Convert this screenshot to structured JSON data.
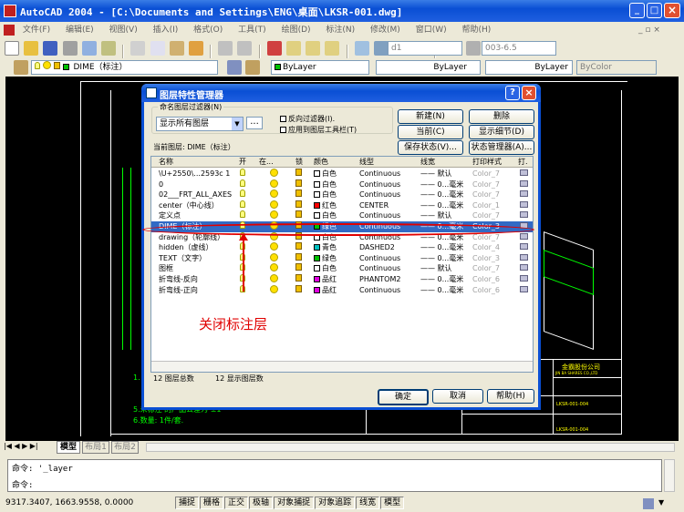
{
  "window": {
    "title": "AutoCAD 2004 - [C:\\Documents and Settings\\ENG\\桌面\\LKSR-001.dwg]",
    "min": "_",
    "max": "□",
    "close": "×"
  },
  "menu": [
    "文件(F)",
    "编辑(E)",
    "视图(V)",
    "插入(I)",
    "格式(O)",
    "工具(T)",
    "绘图(D)",
    "标注(N)",
    "修改(M)",
    "窗口(W)",
    "帮助(H)"
  ],
  "toolbar": {
    "layer_combo": "DIME（标注）",
    "color_combo": "ByLayer",
    "linetype_combo": "ByLayer",
    "lineweight_combo": "ByLayer",
    "plotstyle_combo": "ByColor",
    "dimstyle_combo": "d1",
    "scale_combo": "003-6.5"
  },
  "drawing_text": {
    "note1": "5.未标注 的产品公差为 ±1",
    "note2": "6.数量: 1件/套.",
    "note_num": "1.",
    "company": "金霸股份公司",
    "company_en": "JIN BA SHARES CO.,LTD",
    "partname": "LKSR-001-004",
    "drawing_no": "LKSR-001-004"
  },
  "tabs": {
    "model": "模型",
    "layout1": "布局1",
    "layout2": "布局2"
  },
  "command": {
    "line1": "命令: '_layer",
    "line2": "命令:"
  },
  "status": {
    "coords": "9317.3407,   1663.9558, 0.0000",
    "buttons": [
      "捕捉",
      "栅格",
      "正交",
      "极轴",
      "对象捕捉",
      "对象追踪",
      "线宽",
      "模型"
    ]
  },
  "dialog": {
    "title": "图层特性管理器",
    "filter_label": "命名图层过滤器(N)",
    "filter_value": "显示所有图层",
    "filter_btn": "...",
    "invert_filter": "反向过滤器(I).",
    "apply_toolbar": "应用到图层工具栏(T)",
    "btn_new": "新建(N)",
    "btn_delete": "删除",
    "btn_current": "当前(C)",
    "btn_details": "显示细节(D)",
    "btn_save_state": "保存状态(V)...",
    "btn_state_mgr": "状态管理器(A)...",
    "current_layer_label": "当前图层: DIME（标注）",
    "headers": [
      "名称",
      "开",
      "在...",
      "锁",
      "颜色",
      "线型",
      "线宽",
      "打印样式",
      "打."
    ],
    "layers": [
      {
        "name": "\\U+2550\\...2593c 1",
        "color": "白色",
        "swatch": "#ffffff",
        "linetype": "Continuous",
        "lw": "—— 默认",
        "ps": "Color_7"
      },
      {
        "name": "0",
        "color": "白色",
        "swatch": "#ffffff",
        "linetype": "Continuous",
        "lw": "—— 0...毫米",
        "ps": "Color_7"
      },
      {
        "name": "02___FRT_ALL_AXES",
        "color": "白色",
        "swatch": "#ffffff",
        "linetype": "Continuous",
        "lw": "—— 0...毫米",
        "ps": "Color_7"
      },
      {
        "name": "center（中心线）",
        "color": "红色",
        "swatch": "#ff0000",
        "linetype": "CENTER",
        "lw": "—— 0...毫米",
        "ps": "Color_1"
      },
      {
        "name": "定义点",
        "color": "白色",
        "swatch": "#ffffff",
        "linetype": "Continuous",
        "lw": "—— 默认",
        "ps": "Color_7"
      },
      {
        "name": "DIME（标注）",
        "color": "绿色",
        "swatch": "#00c000",
        "linetype": "Continuous",
        "lw": "—— 0...毫米",
        "ps": "Color_3"
      },
      {
        "name": "drawing（轮廓线）",
        "color": "白色",
        "swatch": "#ffffff",
        "linetype": "Continuous",
        "lw": "—— 0...毫米",
        "ps": "Color_7"
      },
      {
        "name": "hidden（虚线）",
        "color": "青色",
        "swatch": "#00c0c0",
        "linetype": "DASHED2",
        "lw": "—— 0...毫米",
        "ps": "Color_4"
      },
      {
        "name": "TEXT（文字）",
        "color": "绿色",
        "swatch": "#00c000",
        "linetype": "Continuous",
        "lw": "—— 0...毫米",
        "ps": "Color_3"
      },
      {
        "name": "图框",
        "color": "白色",
        "swatch": "#ffffff",
        "linetype": "Continuous",
        "lw": "—— 默认",
        "ps": "Color_7"
      },
      {
        "name": "折弯线-反向",
        "color": "品红",
        "swatch": "#e000e0",
        "linetype": "PHANTOM2",
        "lw": "—— 0...毫米",
        "ps": "Color_6"
      },
      {
        "name": "折弯线-正向",
        "color": "品红",
        "swatch": "#e000e0",
        "linetype": "Continuous",
        "lw": "—— 0...毫米",
        "ps": "Color_6"
      }
    ],
    "annotation": "关闭标注层",
    "total_label": "12 图层总数",
    "shown_label": "12 显示图层数",
    "btn_ok": "确定",
    "btn_cancel": "取消",
    "btn_help": "帮助(H)"
  }
}
